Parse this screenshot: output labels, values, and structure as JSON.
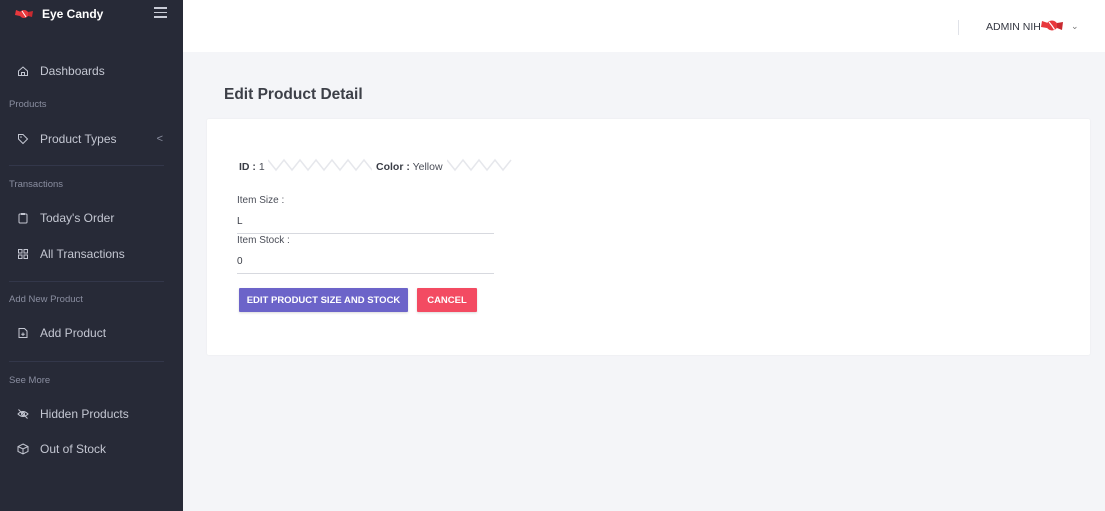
{
  "sidebar": {
    "brand": "Eye Candy",
    "items": {
      "dashboards": "Dashboards",
      "product_types": "Product Types",
      "product_types_chevron": "<",
      "todays_order": "Today's Order",
      "all_transactions": "All Transactions",
      "add_product": "Add Product",
      "hidden_products": "Hidden Products",
      "out_of_stock": "Out of Stock"
    },
    "sections": {
      "products": "Products",
      "transactions": "Transactions",
      "add_new_product": "Add New Product",
      "see_more": "See More"
    }
  },
  "header": {
    "username": "ADMIN NIH",
    "caret": "⌄"
  },
  "main": {
    "title": "Edit Product Detail",
    "id_label": "ID :",
    "id_value": "1",
    "color_label": "Color :",
    "color_value": "Yellow",
    "item_size_label": "Item Size :",
    "item_size_value": "L",
    "item_stock_label": "Item Stock :",
    "item_stock_value": "0",
    "edit_button": "EDIT PRODUCT SIZE AND STOCK",
    "cancel_button": "CANCEL"
  },
  "colors": {
    "sidebar_bg": "#272a37",
    "edit_button": "#6c64c9",
    "cancel_button": "#f34b62",
    "page_bg": "#f4f5f8"
  }
}
